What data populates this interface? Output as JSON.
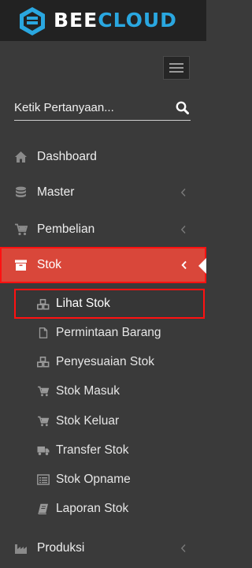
{
  "brand": {
    "name_part1": "BEE",
    "name_part2": "CLOUD",
    "accent": "#2aa7e0"
  },
  "search": {
    "placeholder": "Ketik Pertanyaan...",
    "icon": "search-icon"
  },
  "menu": {
    "dashboard": {
      "label": "Dashboard",
      "icon": "home-icon"
    },
    "master": {
      "label": "Master",
      "icon": "database-icon"
    },
    "pembelian": {
      "label": "Pembelian",
      "icon": "cart-icon"
    },
    "stok": {
      "label": "Stok",
      "icon": "box-icon",
      "active_color": "#d9473a"
    },
    "produksi": {
      "label": "Produksi",
      "icon": "factory-icon"
    }
  },
  "submenu": {
    "lihat_stok": {
      "label": "Lihat Stok",
      "icon": "cubes-icon"
    },
    "permintaan_barang": {
      "label": "Permintaan Barang",
      "icon": "file-icon"
    },
    "penyesuaian_stok": {
      "label": "Penyesuaian Stok",
      "icon": "cubes-icon"
    },
    "stok_masuk": {
      "label": "Stok Masuk",
      "icon": "cart-icon"
    },
    "stok_keluar": {
      "label": "Stok Keluar",
      "icon": "cart-icon"
    },
    "transfer_stok": {
      "label": "Transfer Stok",
      "icon": "truck-icon"
    },
    "stok_opname": {
      "label": "Stok Opname",
      "icon": "list-icon"
    },
    "laporan_stok": {
      "label": "Laporan Stok",
      "icon": "book-icon"
    }
  }
}
